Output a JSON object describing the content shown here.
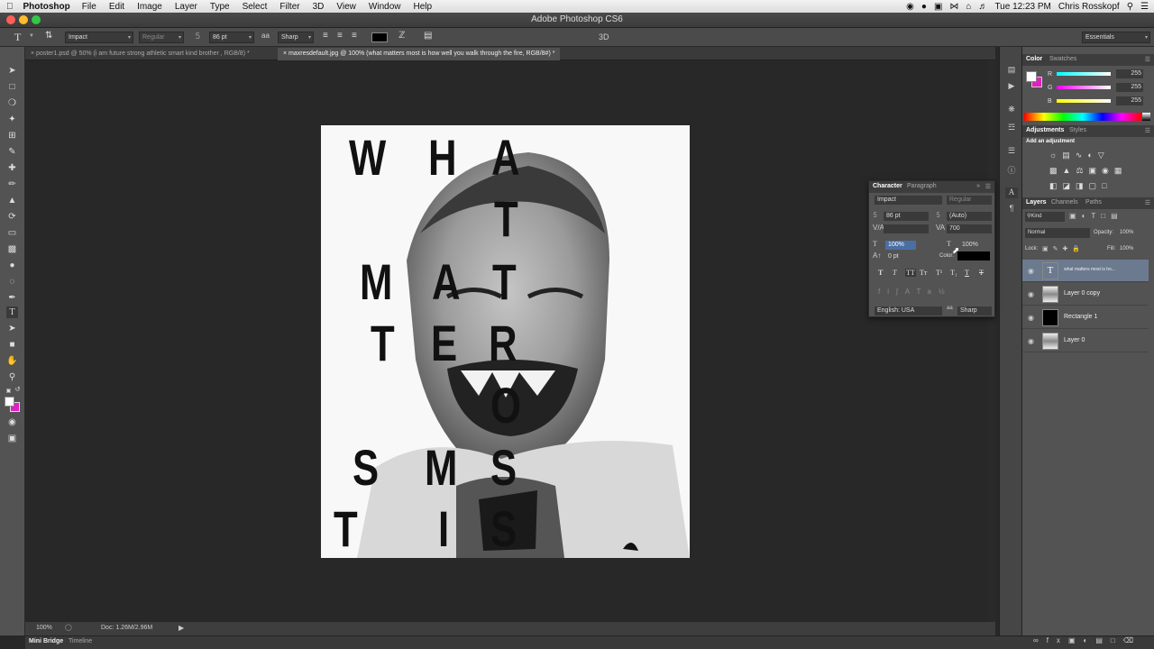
{
  "menubar": {
    "app_name": "Photoshop",
    "items": [
      "File",
      "Edit",
      "Image",
      "Layer",
      "Type",
      "Select",
      "Filter",
      "3D",
      "View",
      "Window",
      "Help"
    ],
    "clock": "Tue 12:23 PM",
    "user": "Chris Rosskopf"
  },
  "window": {
    "title": "Adobe Photoshop CS6"
  },
  "options": {
    "font_family": "Impact",
    "font_style": "Regular",
    "font_size": "86 pt",
    "antialias": "Sharp",
    "mode_3d": "3D",
    "workspace": "Essentials"
  },
  "tabs": [
    {
      "label": "poster1.psd @ 50% (i am future strong athletic smart kind brother , RGB/8) *"
    },
    {
      "label": "maxresdefault.jpg @ 100% (what matters most is how well you walk through the fire, RGB/8#) *"
    }
  ],
  "canvas": {
    "letters": [
      "W",
      "H",
      "A",
      "T",
      "M",
      "A",
      "T",
      "T",
      "E",
      "R",
      "S",
      "M",
      "O",
      "S",
      "T",
      "I",
      "S"
    ]
  },
  "status": {
    "zoom": "100%",
    "doc": "Doc: 1.26M/2.96M"
  },
  "bottom_tabs": [
    "Mini Bridge",
    "Timeline"
  ],
  "color_panel": {
    "tabs": [
      "Color",
      "Swatches"
    ],
    "r": "255",
    "g": "255",
    "b": "255",
    "r_label": "R",
    "g_label": "G",
    "b_label": "B"
  },
  "adjustments_panel": {
    "tabs": [
      "Adjustments",
      "Styles"
    ],
    "subtitle": "Add an adjustment"
  },
  "layers_panel": {
    "tabs": [
      "Layers",
      "Channels",
      "Paths"
    ],
    "kind": "Kind",
    "blend_mode": "Normal",
    "opacity_label": "Opacity:",
    "opacity": "100%",
    "lock_label": "Lock:",
    "fill_label": "Fill:",
    "fill": "100%",
    "layers": [
      {
        "name": "what matters most is ho..."
      },
      {
        "name": "Layer 0 copy"
      },
      {
        "name": "Rectangle 1"
      },
      {
        "name": "Layer 0"
      }
    ]
  },
  "character_panel": {
    "tabs": [
      "Character",
      "Paragraph"
    ],
    "font_family": "Impact",
    "font_style": "Regular",
    "size": "86 pt",
    "leading": "(Auto)",
    "tracking": "700",
    "vertical_scale": "100%",
    "horizontal_scale": "100%",
    "baseline_shift": "0 pt",
    "color_label": "Color:",
    "color": "#000000",
    "language": "English: USA",
    "antialias": "Sharp"
  },
  "colors": {
    "foreground": "#ffffff",
    "background": "#e020c0"
  }
}
